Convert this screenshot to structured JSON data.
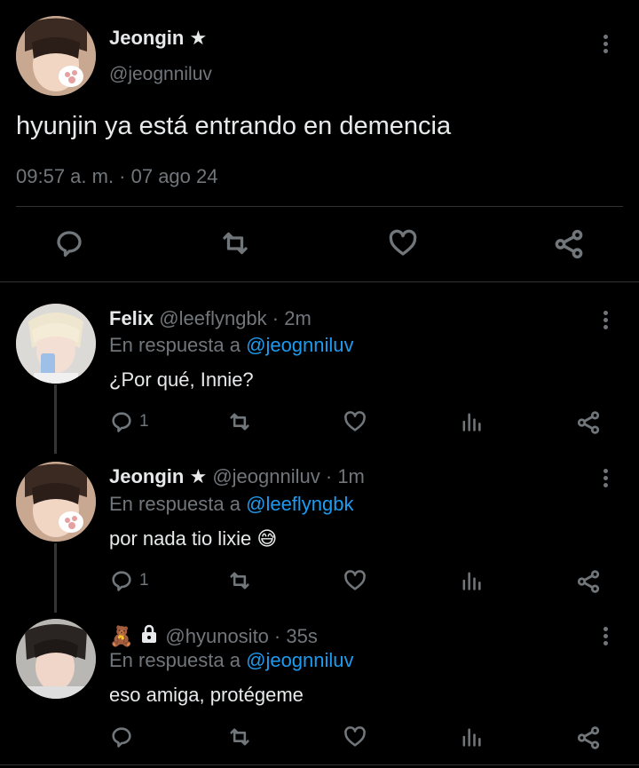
{
  "main_tweet": {
    "author_name": "Jeongin",
    "author_badge": "★",
    "handle": "@jeognniluv",
    "text": "hyunjin ya está entrando en demencia",
    "timestamp": "09:57 a. m. · 07 ago 24"
  },
  "replies": [
    {
      "author_name": "Felix",
      "handle": "@leeflyngbk",
      "time": "· 2m",
      "reply_prefix": "En respuesta a",
      "reply_to": "@jeognniluv",
      "text": "¿Por qué, Innie?",
      "reply_count": "1"
    },
    {
      "author_name": "Jeongin",
      "author_badge": "★",
      "handle": "@jeognniluv",
      "time": "· 1m",
      "reply_prefix": "En respuesta a",
      "reply_to": "@leeflyngbk",
      "text": "por nada tio lixie 😅",
      "reply_count": "1"
    },
    {
      "author_name": "🧸",
      "handle": "@hyunosito",
      "time": "· 35s",
      "reply_prefix": "En respuesta a",
      "reply_to": "@jeognniluv",
      "text": "eso amiga, protégeme",
      "reply_count": ""
    }
  ],
  "colors": {
    "background": "#000000",
    "text": "#e7e9ea",
    "secondary": "#71767b",
    "link": "#1d9bf0",
    "divider": "#2f3336"
  },
  "icons": [
    "comment-icon",
    "retweet-icon",
    "heart-icon",
    "share-icon",
    "views-icon",
    "more-icon",
    "lock-icon"
  ]
}
